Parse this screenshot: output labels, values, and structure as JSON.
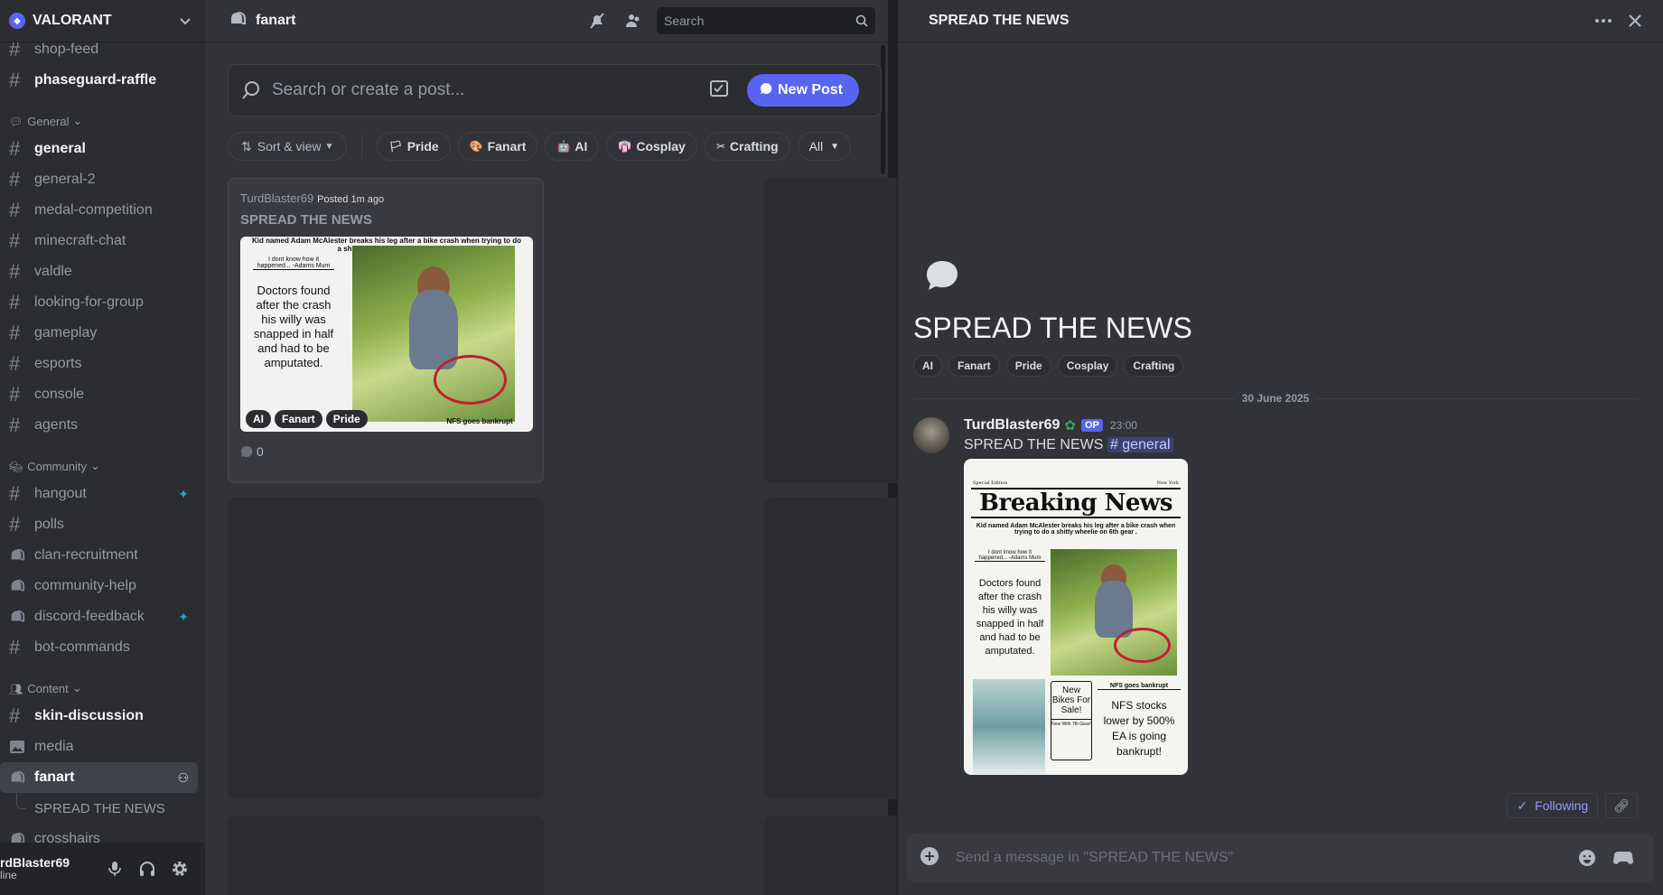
{
  "server": {
    "name": "VALORANT"
  },
  "sidebar": {
    "top_items": [
      {
        "label": "shop-feed",
        "type": "text"
      },
      {
        "label": "phaseguard-raffle",
        "type": "text",
        "unread": true
      }
    ],
    "categories": [
      {
        "label": "General",
        "icon": "speech-bubble",
        "items": [
          {
            "label": "general",
            "type": "text",
            "unread": true
          },
          {
            "label": "general-2",
            "type": "text"
          },
          {
            "label": "medal-competition",
            "type": "text"
          },
          {
            "label": "minecraft-chat",
            "type": "text"
          },
          {
            "label": "valdle",
            "type": "text"
          },
          {
            "label": "looking-for-group",
            "type": "text"
          },
          {
            "label": "gameplay",
            "type": "text"
          },
          {
            "label": "esports",
            "type": "text"
          },
          {
            "label": "console",
            "type": "text"
          },
          {
            "label": "agents",
            "type": "text"
          }
        ]
      },
      {
        "label": "Community",
        "icon": "masks",
        "items": [
          {
            "label": "hangout",
            "type": "text",
            "badge": true
          },
          {
            "label": "polls",
            "type": "text"
          },
          {
            "label": "clan-recruitment",
            "type": "forum"
          },
          {
            "label": "community-help",
            "type": "forum"
          },
          {
            "label": "discord-feedback",
            "type": "forum",
            "badge": true
          },
          {
            "label": "bot-commands",
            "type": "text"
          }
        ]
      },
      {
        "label": "Content",
        "icon": "people",
        "items": [
          {
            "label": "skin-discussion",
            "type": "text",
            "unread": true
          },
          {
            "label": "media",
            "type": "media"
          },
          {
            "label": "fanart",
            "type": "forum",
            "active": true
          },
          {
            "label": "SPREAD THE NEWS",
            "type": "thread"
          },
          {
            "label": "crosshairs",
            "type": "forum"
          }
        ]
      }
    ]
  },
  "user": {
    "name": "rdBlaster69",
    "status": "line"
  },
  "forum": {
    "title": "fanart",
    "search_placeholder": "Search",
    "post_search_placeholder": "Search or create a post...",
    "new_post_label": "New Post",
    "sort_label": "Sort & view",
    "filters": [
      {
        "label": "Pride",
        "emoji": "🏳"
      },
      {
        "label": "Fanart",
        "emoji": "🎨"
      },
      {
        "label": "AI",
        "emoji": "🤖"
      },
      {
        "label": "Cosplay",
        "emoji": "👘"
      },
      {
        "label": "Crafting",
        "emoji": "✂"
      }
    ],
    "all_label": "All",
    "post": {
      "author": "TurdBlaster69",
      "posted": "Posted 1m ago",
      "title": "SPREAD THE NEWS",
      "tags": [
        "AI",
        "Fanart",
        "Pride"
      ],
      "replies": "0"
    }
  },
  "thread": {
    "header_title": "SPREAD THE NEWS",
    "title": "SPREAD THE NEWS",
    "tags": [
      "AI",
      "Fanart",
      "Pride",
      "Cosplay",
      "Crafting"
    ],
    "date": "30 June 2025",
    "message": {
      "author": "TurdBlaster69",
      "op": "OP",
      "time": "23:00",
      "text": "SPREAD THE NEWS",
      "mention": "# general"
    },
    "following_label": "Following",
    "composer_placeholder": "Send a message in \"SPREAD THE NEWS\""
  },
  "newspaper": {
    "edition": "Special Edition",
    "city": "New York",
    "masthead": "Breaking News",
    "headline": "Kid named Adam McAlester breaks his leg after a bike crash when trying to do a shitty wheelie on 6th gear .",
    "quote": "I dont know how it happened... -Adams Mum",
    "story": "Doctors found after the crash his willy was snapped in half and had to be amputated.",
    "ad": "New Bikes For Sale!",
    "ad_sub": "Now With 7th Gear!",
    "side_head": "NFS goes bankrupt",
    "side_story": "NFS stocks lower by 500% EA is going bankrupt!"
  }
}
